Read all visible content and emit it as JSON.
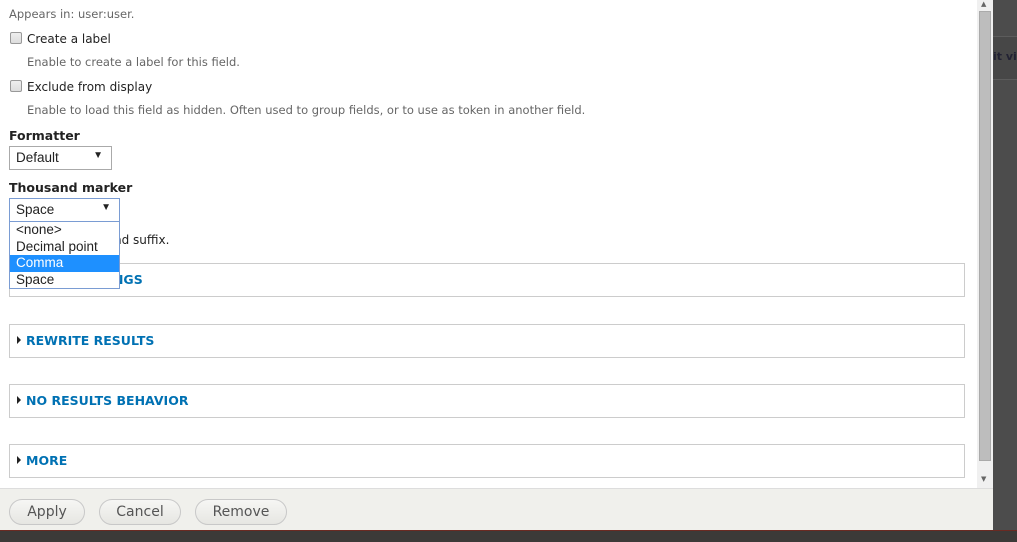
{
  "background": {
    "edit_view_fragment": "it vi"
  },
  "appears_in": "Appears in: user:user.",
  "create_label": {
    "label": "Create a label",
    "description": "Enable to create a label for this field.",
    "checked": false
  },
  "exclude": {
    "label": "Exclude from display",
    "description": "Enable to load this field as hidden. Often used to group fields, or to use as token in another field.",
    "checked": false
  },
  "formatter": {
    "label": "Formatter",
    "value": "Default"
  },
  "thousand": {
    "label": "Thousand marker",
    "value": "Space",
    "options": [
      "<none>",
      "Decimal point",
      "Comma",
      "Space"
    ],
    "highlighted": "Comma"
  },
  "prefix_suffix_fragment": "nd suffix.",
  "fieldsets": [
    "STYLE SETTINGS",
    "REWRITE RESULTS",
    "NO RESULTS BEHAVIOR",
    "MORE"
  ],
  "buttons": {
    "apply": "Apply",
    "cancel": "Cancel",
    "remove": "Remove"
  },
  "colors": {
    "link": "#0071b3",
    "highlight": "#1e90ff"
  }
}
